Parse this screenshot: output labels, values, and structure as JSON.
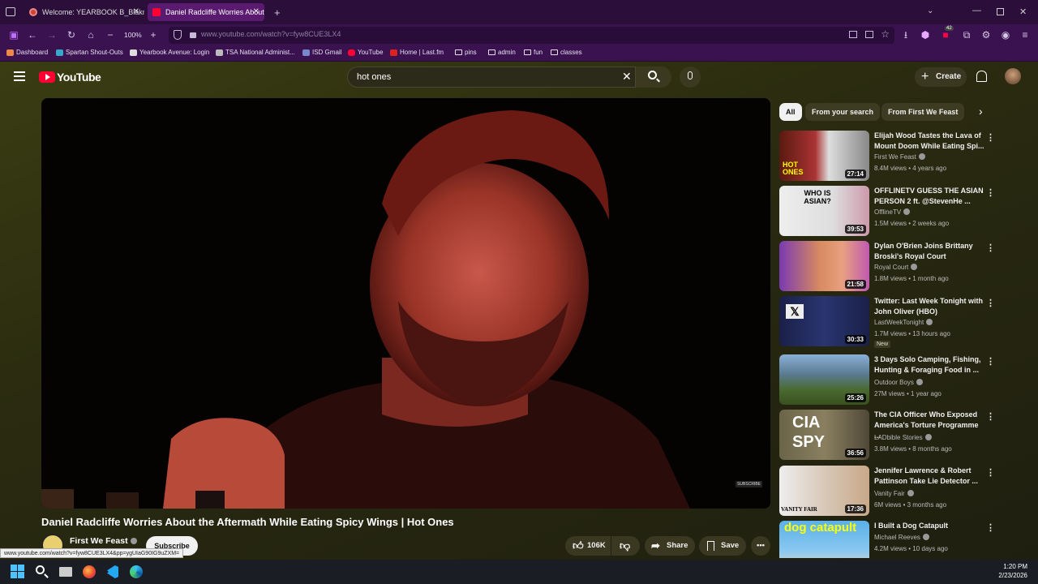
{
  "browser": {
    "tabs": [
      {
        "label": "Welcome: YEARBOOK B_Blakne"
      },
      {
        "label": "Daniel Radcliffe Worries About"
      }
    ],
    "zoom": "100%",
    "url": "www.youtube.com/watch?v=fyw8CUE3LX4",
    "bookmarks": [
      "Dashboard",
      "Spartan Shout-Outs",
      "Yearbook Avenue: Login",
      "TSA National Administ...",
      "ISD Gmail",
      "YouTube",
      "Home | Last.fm",
      "pins",
      "admin",
      "fun",
      "classes"
    ],
    "notification_count": "42",
    "status_url": "www.youtube.com/watch?v=fyw8CUE3LX4&pp=ygUIaG90IG9uZXM="
  },
  "youtube": {
    "logo_text": "YouTube",
    "search_value": "hot ones",
    "create_label": "Create",
    "chips": [
      "All",
      "From your search",
      "From First We Feast"
    ],
    "video": {
      "title": "Daniel Radcliffe Worries About the Aftermath While Eating Spicy Wings | Hot Ones",
      "channel": "First We Feast",
      "subscribe_label": "Subscribe",
      "likes": "106K",
      "share_label": "Share",
      "save_label": "Save",
      "overlay_text": "SUBSCRIBE"
    },
    "recommendations": [
      {
        "title": "Elijah Wood Tastes the Lava of Mount Doom While Eating Spi...",
        "channel": "First We Feast",
        "meta": "8.4M views • 4 years ago",
        "duration": "27:14",
        "thumb_text": "HOT ONES"
      },
      {
        "title": "OFFLINETV GUESS THE ASIAN PERSON 2 ft. @StevenHe ...",
        "channel": "OfflineTV",
        "meta": "1.5M views • 2 weeks ago",
        "duration": "39:53",
        "thumb_text": "WHO IS ASIAN?"
      },
      {
        "title": "Dylan O'Brien Joins Brittany Broski's Royal Court",
        "channel": "Royal Court",
        "meta": "1.8M views • 1 month ago",
        "duration": "21:58",
        "thumb_text": ""
      },
      {
        "title": "Twitter: Last Week Tonight with John Oliver (HBO)",
        "channel": "LastWeekTonight",
        "meta": "1.7M views • 13 hours ago",
        "duration": "30:33",
        "badge": "New",
        "thumb_text": ""
      },
      {
        "title": "3 Days Solo Camping, Fishing, Hunting & Foraging Food in ...",
        "channel": "Outdoor Boys",
        "meta": "27M views • 1 year ago",
        "duration": "25:26",
        "thumb_text": ""
      },
      {
        "title": "The CIA Officer Who Exposed America's Torture Programme ...",
        "channel": "LADbible Stories",
        "meta": "3.8M views • 8 months ago",
        "duration": "36:56",
        "thumb_text": "CIA SPY"
      },
      {
        "title": "Jennifer Lawrence & Robert Pattinson Take Lie Detector ...",
        "channel": "Vanity Fair",
        "meta": "6M views • 3 months ago",
        "duration": "17:36",
        "thumb_text": "VANITY FAIR"
      },
      {
        "title": "I Built a Dog Catapult",
        "channel": "Michael Reeves",
        "meta": "4.2M views • 10 days ago",
        "duration": "",
        "thumb_text": "dog catapult"
      }
    ]
  },
  "taskbar": {
    "time": "1:20 PM",
    "date": "2/23/2026"
  },
  "colors": {
    "browser_bg": "#2b0f3a",
    "yt_red": "#ff0033",
    "ambient": "#3a3d12"
  }
}
